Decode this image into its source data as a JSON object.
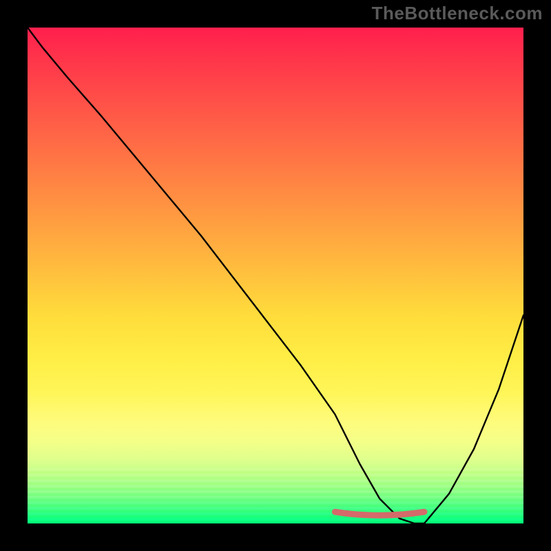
{
  "watermark": "TheBottleneck.com",
  "colors": {
    "bg": "#000000",
    "curve": "#000000",
    "marker": "#d46a6a",
    "watermark": "#5a5a5a"
  },
  "chart_data": {
    "type": "line",
    "title": "",
    "xlabel": "",
    "ylabel": "",
    "xlim": [
      0,
      100
    ],
    "ylim": [
      0,
      100
    ],
    "series": [
      {
        "name": "curve",
        "x": [
          0,
          3,
          8,
          15,
          25,
          35,
          45,
          55,
          62,
          67,
          71,
          75,
          78,
          80,
          85,
          90,
          95,
          100
        ],
        "y": [
          100,
          96,
          90,
          82,
          70,
          58,
          45,
          32,
          22,
          12,
          5,
          1,
          0,
          0,
          6,
          15,
          27,
          42
        ]
      }
    ],
    "highlight": {
      "name": "optimal-range",
      "x": [
        62,
        80
      ],
      "y": [
        1.5,
        1.5
      ]
    },
    "grid": false,
    "legend": false
  }
}
